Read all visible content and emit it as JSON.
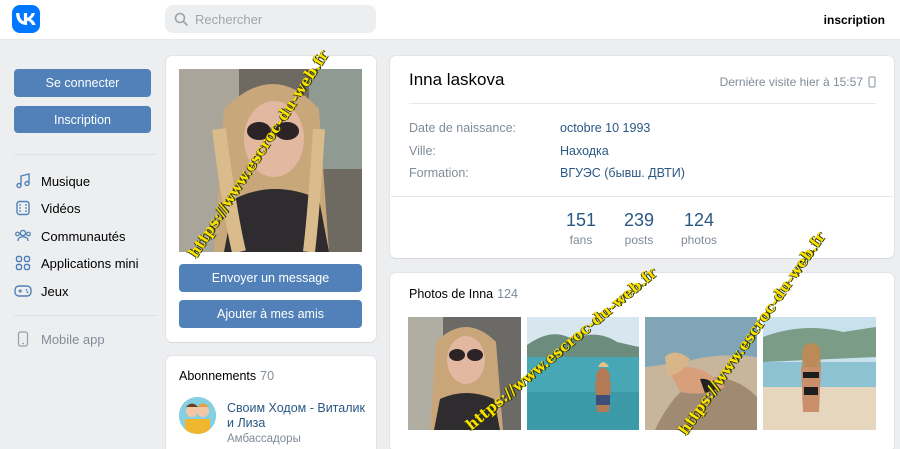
{
  "header": {
    "search_placeholder": "Rechercher",
    "signup_link": "inscription"
  },
  "left_nav": {
    "login_button": "Se connecter",
    "signup_button": "Inscription",
    "items": [
      {
        "label": "Musique",
        "icon": "music-icon"
      },
      {
        "label": "Vidéos",
        "icon": "video-icon"
      },
      {
        "label": "Communautés",
        "icon": "communities-icon"
      },
      {
        "label": "Applications mini",
        "icon": "apps-icon"
      },
      {
        "label": "Jeux",
        "icon": "gamepad-icon"
      }
    ],
    "mobile_app": "Mobile app"
  },
  "profile_actions": {
    "message_button": "Envoyer un message",
    "add_friend_button": "Ajouter à mes amis"
  },
  "subscriptions": {
    "title": "Abonnements",
    "count": "70",
    "item_name": "Своим Ходом - Виталик и Лиза",
    "item_subtitle": "Амбассадоры"
  },
  "profile": {
    "name": "Inna laskova",
    "last_seen": "Dernière visite hier à 15:57",
    "info": [
      {
        "label": "Date de naissance:",
        "value": "octobre 10 1993"
      },
      {
        "label": "Ville:",
        "value": "Находка"
      },
      {
        "label": "Formation:",
        "value": "ВГУЭС (бывш. ДВТИ)"
      }
    ],
    "stats": [
      {
        "value": "151",
        "label": "fans"
      },
      {
        "value": "239",
        "label": "posts"
      },
      {
        "value": "124",
        "label": "photos"
      }
    ]
  },
  "photos": {
    "title": "Photos de Inna",
    "count": "124"
  },
  "watermark": "https://www.escroc-du-web.fr",
  "colors": {
    "vk_blue": "#0077ff",
    "button_blue": "#5181b8",
    "link": "#2a5885",
    "muted": "#818c99",
    "watermark": "#ffe100"
  }
}
